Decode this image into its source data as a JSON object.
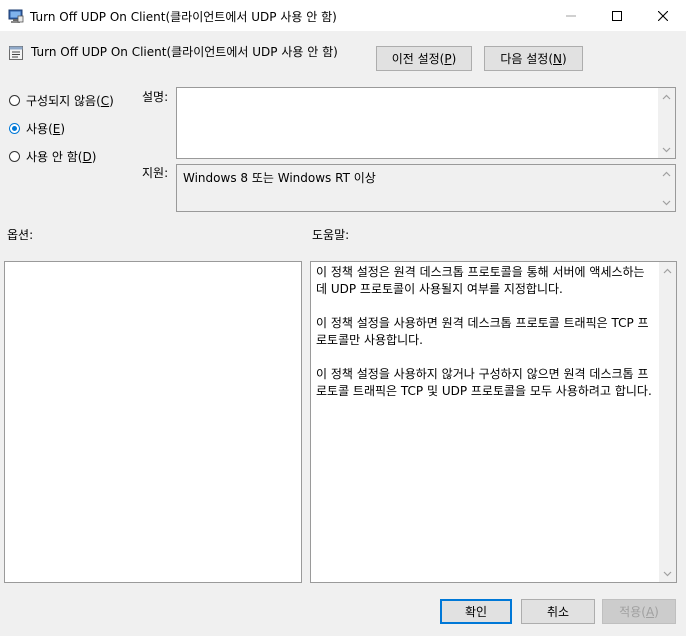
{
  "window": {
    "title": "Turn Off UDP On Client(클라이언트에서 UDP 사용 안 함)"
  },
  "header": {
    "title": "Turn Off UDP On Client(클라이언트에서 UDP 사용 안 함)",
    "prev_label": "이전 설정",
    "prev_key": "P",
    "next_label": "다음 설정",
    "next_key": "N"
  },
  "radios": {
    "not_configured": {
      "label": "구성되지 않음",
      "key": "C",
      "checked": false
    },
    "enabled": {
      "label": "사용",
      "key": "E",
      "checked": true
    },
    "disabled": {
      "label": "사용 안 함",
      "key": "D",
      "checked": false
    }
  },
  "comment": {
    "label": "설명:",
    "value": ""
  },
  "supported": {
    "label": "지원:",
    "value": "Windows 8 또는 Windows RT 이상"
  },
  "options": {
    "label": "옵션:"
  },
  "help": {
    "label": "도움말:",
    "paragraphs": [
      "이 정책 설정은 원격 데스크톱 프로토콜을 통해 서버에 액세스하는 데 UDP 프로토콜이 사용될지 여부를 지정합니다.",
      "이 정책 설정을 사용하면 원격 데스크톱 프로토콜 트래픽은 TCP 프로토콜만 사용합니다.",
      "이 정책 설정을 사용하지 않거나 구성하지 않으면 원격 데스크톱 프로토콜 트래픽은 TCP 및 UDP 프로토콜을 모두 사용하려고 합니다."
    ]
  },
  "footer": {
    "ok_label": "확인",
    "cancel_label": "취소",
    "apply_label": "적용",
    "apply_key": "A"
  },
  "colors": {
    "accent": "#0078d7",
    "dialog_bg": "#f0f0f0",
    "disabled_text": "#a0a0a0"
  }
}
